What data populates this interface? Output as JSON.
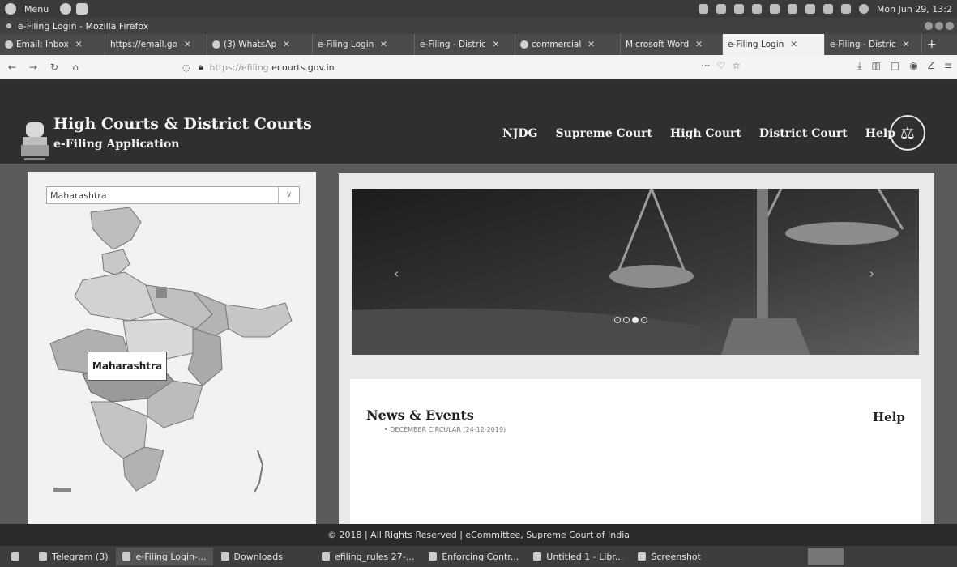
{
  "os_bar": {
    "menu_label": "Menu",
    "clock": "Mon Jun 29, 13:2"
  },
  "window": {
    "title": "e-Filing Login - Mozilla Firefox"
  },
  "browser": {
    "tabs": [
      {
        "label": "Email: Inbox",
        "active": false
      },
      {
        "label": "https://email.go",
        "active": false
      },
      {
        "label": "(3) WhatsAp",
        "active": false
      },
      {
        "label": "e-Filing Login",
        "active": false
      },
      {
        "label": "e-Filing - Distric",
        "active": false
      },
      {
        "label": "commercial",
        "active": false
      },
      {
        "label": "Microsoft Word",
        "active": false
      },
      {
        "label": "e-Filing Login",
        "active": true
      },
      {
        "label": "e-Filing - Distric",
        "active": false
      }
    ],
    "url_prefix": "https://efiling.",
    "url_domain": "ecourts.gov.in",
    "url_menu": "···"
  },
  "header": {
    "title": "High Courts & District Courts",
    "subtitle": "e-Filing Application",
    "nav": [
      "NJDG",
      "Supreme Court",
      "High Court",
      "District Court",
      "Help"
    ]
  },
  "map_panel": {
    "selected_state": "Maharashtra",
    "tooltip": "Maharashtra"
  },
  "news": {
    "title": "News & Events",
    "help_title": "Help",
    "item": "DECEMBER CIRCULAR (24-12-2019)"
  },
  "footer": {
    "text": "© 2018 | All Rights Reserved | eCommittee, Supreme Court of India"
  },
  "taskbar": {
    "items": [
      {
        "label": "Telegram (3)",
        "active": false
      },
      {
        "label": "e-Filing Login-...",
        "active": true
      },
      {
        "label": "Downloads",
        "active": false
      },
      {
        "label": "efiling_rules 27-...",
        "active": false
      },
      {
        "label": "Enforcing Contr...",
        "active": false
      },
      {
        "label": "Untitled 1 - Libr...",
        "active": false
      },
      {
        "label": "Screenshot",
        "active": false
      }
    ]
  }
}
